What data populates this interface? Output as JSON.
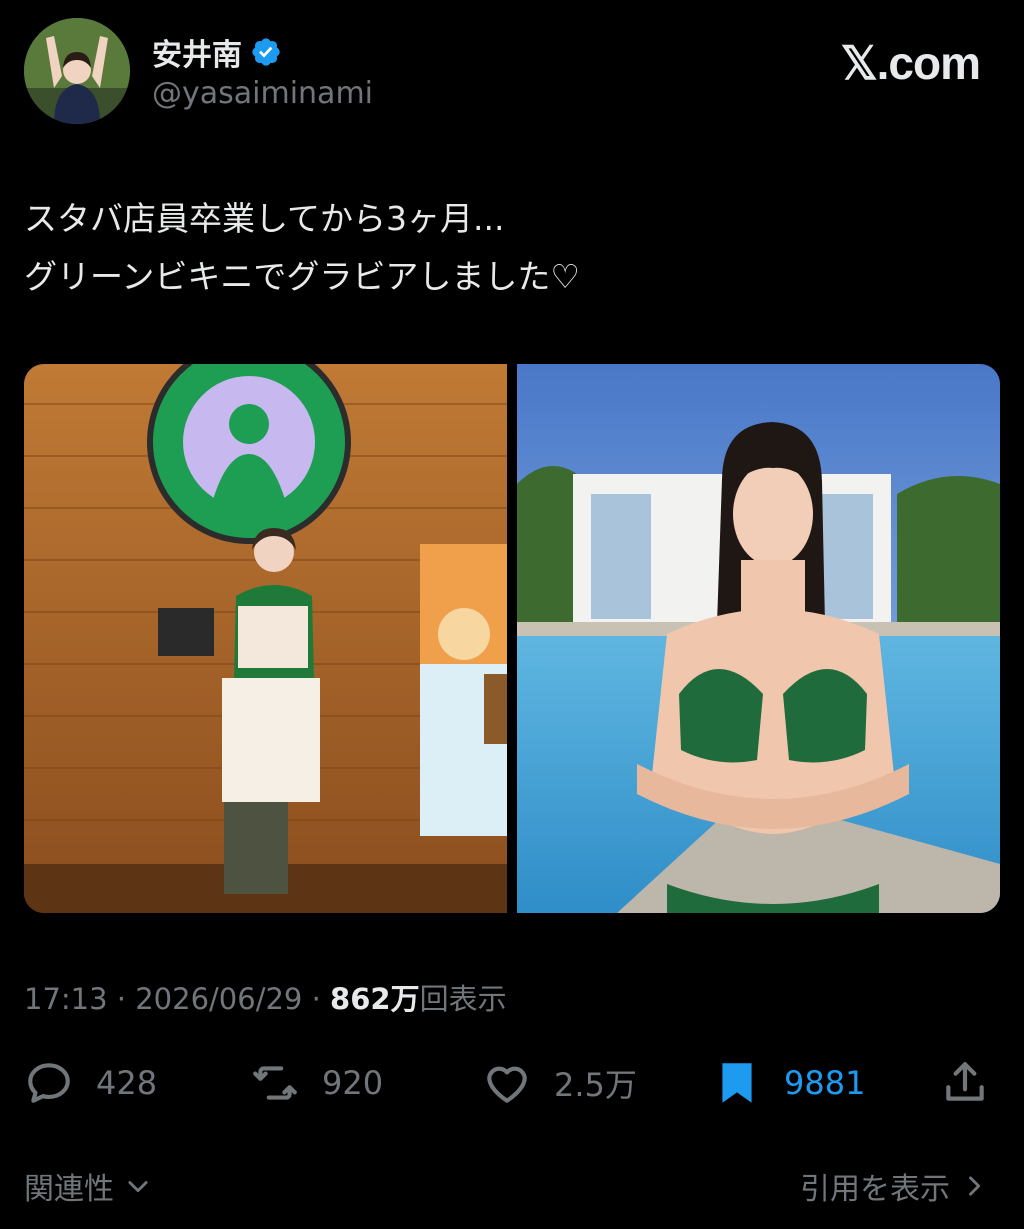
{
  "author": {
    "display_name": "安井南",
    "handle": "@yasaiminami",
    "verified": true,
    "avatar_icon": "avatar-photo"
  },
  "brand": "𝕏.com",
  "tweet": {
    "lines": [
      "スタバ店員卒業してから3ヶ月...",
      "グリーンビキニでグラビアしました♡"
    ]
  },
  "media": [
    {
      "icon": "photo-starbucks-store"
    },
    {
      "icon": "photo-green-bikini-pool"
    }
  ],
  "meta": {
    "time": "17:13",
    "sep1": " · ",
    "date": "2026/06/29",
    "sep2": " · ",
    "views_count": "862万",
    "views_label": "回表示"
  },
  "actions": {
    "reply_count": "428",
    "repost_count": "920",
    "like_count": "2.5万",
    "bookmark_count": "9881",
    "bookmark_active_color": "#1d9bf0",
    "icons": [
      "reply-icon",
      "repost-icon",
      "like-icon",
      "bookmark-icon",
      "share-icon"
    ]
  },
  "footer": {
    "related_label": "関連性",
    "quotes_label": "引用を表示"
  }
}
